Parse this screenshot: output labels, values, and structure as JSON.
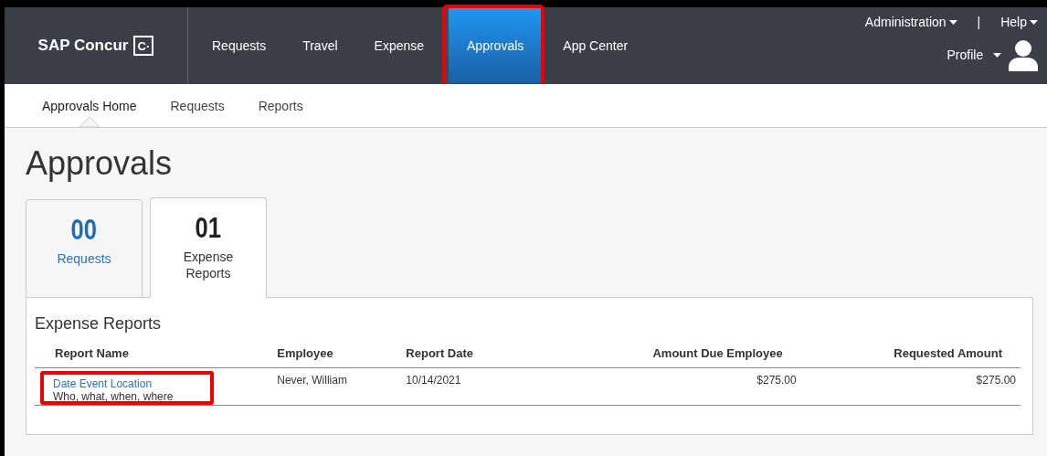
{
  "brand": {
    "name": "SAP Concur",
    "mark": "C·"
  },
  "nav": [
    {
      "label": "Requests",
      "selected": false,
      "highlighted": false
    },
    {
      "label": "Travel",
      "selected": false,
      "highlighted": false
    },
    {
      "label": "Expense",
      "selected": false,
      "highlighted": false
    },
    {
      "label": "Approvals",
      "selected": true,
      "highlighted": true
    },
    {
      "label": "App Center",
      "selected": false,
      "highlighted": false
    }
  ],
  "top_links": [
    {
      "label": "Administration"
    },
    {
      "label": "Help"
    }
  ],
  "top_separator": "|",
  "profile": {
    "label": "Profile"
  },
  "subnav": [
    {
      "label": "Approvals Home",
      "selected": true
    },
    {
      "label": "Requests",
      "selected": false
    },
    {
      "label": "Reports",
      "selected": false
    }
  ],
  "page_title": "Approvals",
  "tabs": [
    {
      "count": "00",
      "label": "Requests",
      "selected": false
    },
    {
      "count": "01",
      "label": "Expense Reports",
      "selected": true
    }
  ],
  "section_title": "Expense Reports",
  "table": {
    "columns": [
      "Report Name",
      "Employee",
      "Report Date",
      "Amount Due Employee",
      "Requested Amount"
    ],
    "rows": [
      {
        "report_name": "Date Event Location",
        "report_purpose": "Who, what, when, where",
        "employee": "Never, William",
        "report_date": "10/14/2021",
        "amount_due": "$275.00",
        "requested_amount": "$275.00",
        "highlighted": true
      }
    ]
  }
}
